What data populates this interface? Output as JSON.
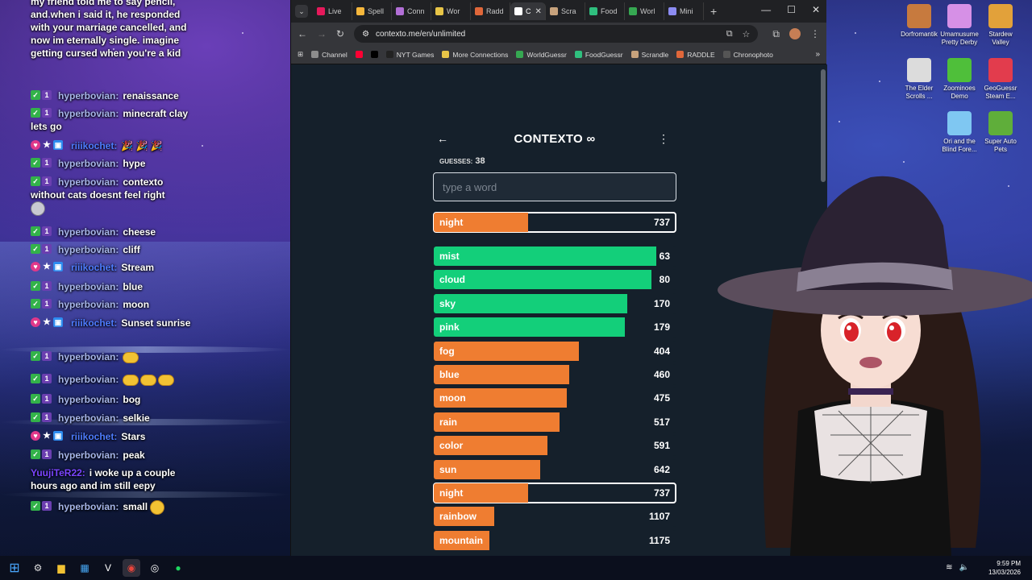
{
  "chat": {
    "messages": [
      {
        "user": "",
        "text": "my friend told me to say pencil, and when i said it, he responded with your marriage cancelled, and now im eternally single. imagine getting cursed when you're a kid",
        "style": "none"
      },
      {
        "user": "hyperbovian:",
        "text": "renaissance",
        "style": "hb"
      },
      {
        "user": "hyperbovian:",
        "text": "minecraft clay lets go",
        "style": "hb"
      },
      {
        "user": "riiikochet:",
        "text": "🎉 🎉 🎉",
        "style": "riii"
      },
      {
        "user": "hyperbovian:",
        "text": "hype",
        "style": "hb"
      },
      {
        "user": "hyperbovian:",
        "text": "contexto without cats doesnt feel right",
        "style": "hb"
      },
      {
        "user": "hyperbovian:",
        "text": "cheese",
        "style": "hb"
      },
      {
        "user": "hyperbovian:",
        "text": "cliff",
        "style": "hb"
      },
      {
        "user": "riiikochet:",
        "text": "Stream",
        "style": "riii"
      },
      {
        "user": "hyperbovian:",
        "text": "blue",
        "style": "hb"
      },
      {
        "user": "hyperbovian:",
        "text": "moon",
        "style": "hb"
      },
      {
        "user": "riiikochet:",
        "text": "Sunset sunrise",
        "style": "riii"
      },
      {
        "user": "hyperbovian:",
        "text": "",
        "style": "hb"
      },
      {
        "user": "hyperbovian:",
        "text": "",
        "style": "hb"
      },
      {
        "user": "hyperbovian:",
        "text": "bog",
        "style": "hb"
      },
      {
        "user": "hyperbovian:",
        "text": "selkie",
        "style": "hb"
      },
      {
        "user": "riiikochet:",
        "text": "Stars",
        "style": "riii"
      },
      {
        "user": "hyperbovian:",
        "text": "peak",
        "style": "hb"
      },
      {
        "user": "YuujiTeR22:",
        "text": "i woke up a couple hours ago and im still eepy",
        "style": "yuuji"
      },
      {
        "user": "hyperbovian:",
        "text": "small",
        "style": "hb"
      }
    ]
  },
  "browser": {
    "tabs": [
      {
        "label": "Live",
        "color": "#e6195b"
      },
      {
        "label": "Spell",
        "color": "#f6b73c"
      },
      {
        "label": "Conn",
        "color": "#b26fd6"
      },
      {
        "label": "Wor",
        "color": "#e8c547"
      },
      {
        "label": "Radd",
        "color": "#e0673a"
      },
      {
        "label": "C",
        "color": "#ffffff",
        "active": true
      },
      {
        "label": "Scra",
        "color": "#c7a27c"
      },
      {
        "label": "Food",
        "color": "#2fbf7e"
      },
      {
        "label": "Worl",
        "color": "#36a852"
      },
      {
        "label": "Mini",
        "color": "#8c8cf2"
      }
    ],
    "url": "contexto.me/en/unlimited",
    "bookmarks": [
      {
        "label": "Channel",
        "color": "#8d8d8d"
      },
      {
        "label": "",
        "color": "#ff0033"
      },
      {
        "label": "",
        "color": "#000000"
      },
      {
        "label": "NYT Games",
        "color": "#222222"
      },
      {
        "label": "More Connections",
        "color": "#e8c547"
      },
      {
        "label": "WorldGuessr",
        "color": "#36a852"
      },
      {
        "label": "FoodGuessr",
        "color": "#2fbf7e"
      },
      {
        "label": "Scrandle",
        "color": "#c7a27c"
      },
      {
        "label": "RADDLE",
        "color": "#e0673a"
      },
      {
        "label": "Chronophoto",
        "color": "#555555"
      }
    ]
  },
  "contexto": {
    "title": "CONTEXTO ∞",
    "guesses_label": "GUESSES:",
    "guesses": "38",
    "input_placeholder": "type a word",
    "last_guess": {
      "word": "night",
      "distance": "737",
      "fill": 0.39,
      "color": "orange"
    },
    "rows": [
      {
        "word": "mist",
        "distance": "63",
        "fill": 0.92,
        "color": "green"
      },
      {
        "word": "cloud",
        "distance": "80",
        "fill": 0.9,
        "color": "green"
      },
      {
        "word": "sky",
        "distance": "170",
        "fill": 0.8,
        "color": "green"
      },
      {
        "word": "pink",
        "distance": "179",
        "fill": 0.79,
        "color": "green"
      },
      {
        "word": "fog",
        "distance": "404",
        "fill": 0.6,
        "color": "orange"
      },
      {
        "word": "blue",
        "distance": "460",
        "fill": 0.56,
        "color": "orange"
      },
      {
        "word": "moon",
        "distance": "475",
        "fill": 0.55,
        "color": "orange"
      },
      {
        "word": "rain",
        "distance": "517",
        "fill": 0.52,
        "color": "orange"
      },
      {
        "word": "color",
        "distance": "591",
        "fill": 0.47,
        "color": "orange"
      },
      {
        "word": "sun",
        "distance": "642",
        "fill": 0.44,
        "color": "orange"
      },
      {
        "word": "night",
        "distance": "737",
        "fill": 0.39,
        "color": "orange",
        "current": true
      },
      {
        "word": "rainbow",
        "distance": "1107",
        "fill": 0.25,
        "color": "orange"
      },
      {
        "word": "mountain",
        "distance": "1175",
        "fill": 0.23,
        "color": "orange"
      }
    ]
  },
  "desktop": {
    "icons": [
      {
        "label": "Dorfromantik",
        "color": "#c77a3e"
      },
      {
        "label": "Umamusume Pretty Derby",
        "color": "#d690e6"
      },
      {
        "label": "Stardew Valley",
        "color": "#e2a13a"
      },
      {
        "label": "The Elder Scrolls ...",
        "color": "#dcdcdc"
      },
      {
        "label": "Zoominoes Demo",
        "color": "#4fbf3a"
      },
      {
        "label": "GeoGuessr Steam E...",
        "color": "#e23c4d"
      },
      {
        "label": "Ori and the Blind Fore...",
        "color": "#7fc7f2"
      },
      {
        "label": "Super Auto Pets",
        "color": "#5fae3a"
      }
    ]
  },
  "taskbar": {
    "time": "9:59 PM",
    "date": "13/03/2026"
  }
}
